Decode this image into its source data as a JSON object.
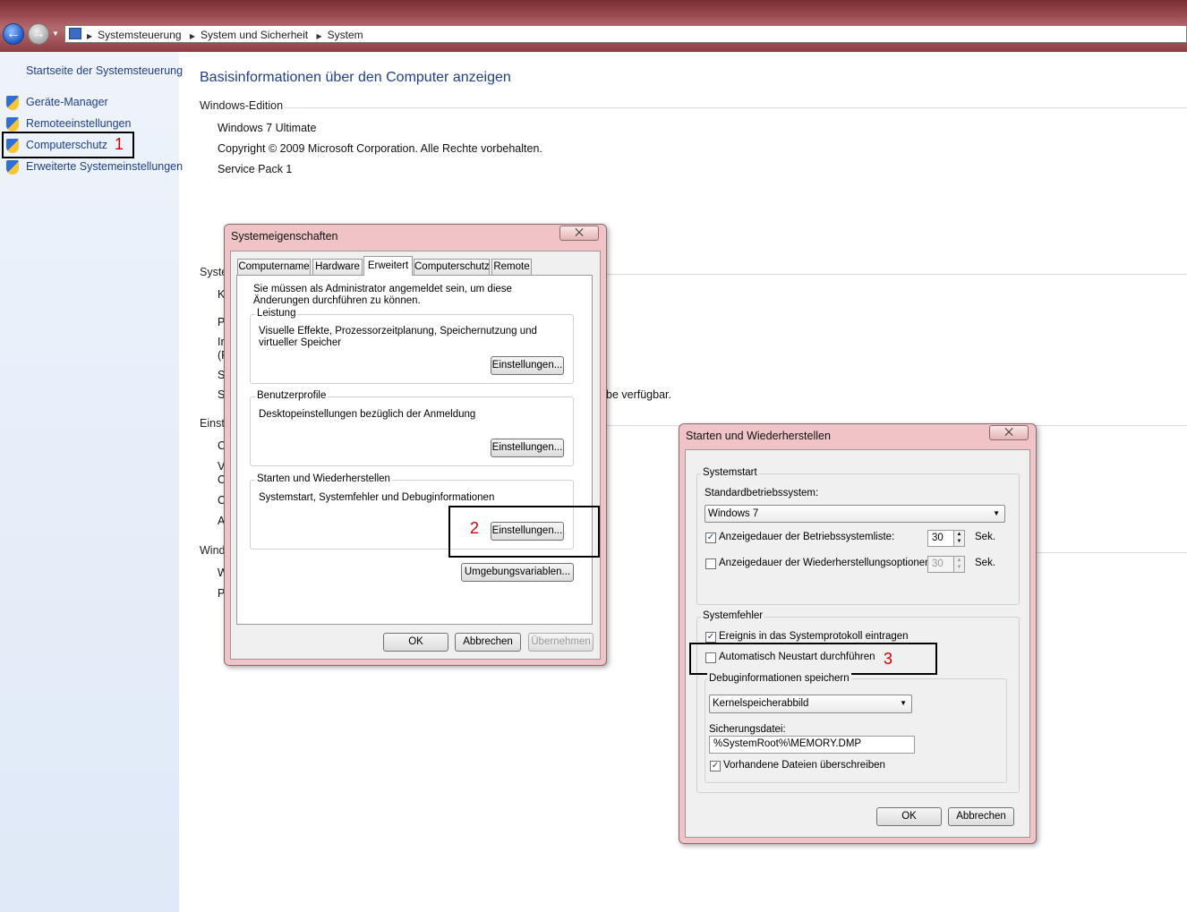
{
  "nav": {
    "back_icon": "back-arrow-icon",
    "forward_icon": "forward-arrow-icon",
    "breadcrumb": [
      "Systemsteuerung",
      "System und Sicherheit",
      "System"
    ]
  },
  "sidebar": {
    "home": "Startseite der Systemsteuerung",
    "items": [
      {
        "label": "Geräte-Manager",
        "icon": "shield-icon"
      },
      {
        "label": "Remoteeinstellungen",
        "icon": "shield-icon"
      },
      {
        "label": "Computerschutz",
        "icon": "shield-icon"
      },
      {
        "label": "Erweiterte Systemeinstellungen",
        "icon": "shield-icon"
      }
    ]
  },
  "main": {
    "title": "Basisinformationen über den Computer anzeigen",
    "edition_header": "Windows-Edition",
    "edition": "Windows 7 Ultimate",
    "copyright": "Copyright © 2009 Microsoft Corporation. Alle Rechte vorbehalten.",
    "service_pack": "Service Pack 1",
    "partial": {
      "syste": "Syste",
      "k": "K",
      "p": "P",
      "i": "Ir",
      "paren": "(F",
      "s1": "S",
      "s2": "S",
      "avail": "be verfügbar.",
      "einst": "Einste",
      "c1": "C",
      "v": "V",
      "c2": "C",
      "c3": "C",
      "a": "A",
      "wind": "Wind",
      "w": "W",
      "p2": "P"
    }
  },
  "annotations": {
    "n1": "1",
    "n2": "2",
    "n3": "3",
    "color": "#d00000"
  },
  "sysprops": {
    "title": "Systemeigenschaften",
    "close": "⨉",
    "tabs": [
      "Computername",
      "Hardware",
      "Erweitert",
      "Computerschutz",
      "Remote"
    ],
    "admin_note": "Sie müssen als Administrator angemeldet sein, um diese Änderungen durchführen zu können.",
    "perf_label": "Leistung",
    "perf_desc": "Visuelle Effekte, Prozessorzeitplanung, Speichernutzung und virtueller Speicher",
    "profiles_label": "Benutzerprofile",
    "profiles_desc": "Desktopeinstellungen bezüglich der Anmeldung",
    "startup_label": "Starten und Wiederherstellen",
    "startup_desc": "Systemstart, Systemfehler und Debuginformationen",
    "settings_btn": "Einstellungen...",
    "env_btn": "Umgebungsvariablen...",
    "ok": "OK",
    "cancel": "Abbrechen",
    "apply": "Übernehmen"
  },
  "startup": {
    "title": "Starten und Wiederherstellen",
    "close": "⨉",
    "sys_start": "Systemstart",
    "default_os_label": "Standardbetriebssystem:",
    "default_os": "Windows 7",
    "show_list_label": "Anzeigedauer der Betriebssystemliste:",
    "show_list_value": "30",
    "show_list_checked": true,
    "show_recovery_label": "Anzeigedauer der Wiederherstellungsoptionen:",
    "show_recovery_value": "30",
    "show_recovery_checked": false,
    "sek": "Sek.",
    "sys_fail": "Systemfehler",
    "log_event_label": "Ereignis in das Systemprotokoll eintragen",
    "log_event_checked": true,
    "auto_restart_label": "Automatisch Neustart durchführen",
    "auto_restart_checked": false,
    "debug_label": "Debuginformationen speichern",
    "debug_value": "Kernelspeicherabbild",
    "dump_label": "Sicherungsdatei:",
    "dump_value": "%SystemRoot%\\MEMORY.DMP",
    "overwrite_label": "Vorhandene Dateien überschreiben",
    "overwrite_checked": true,
    "ok": "OK",
    "cancel": "Abbrechen",
    "check_mark": "✓"
  }
}
